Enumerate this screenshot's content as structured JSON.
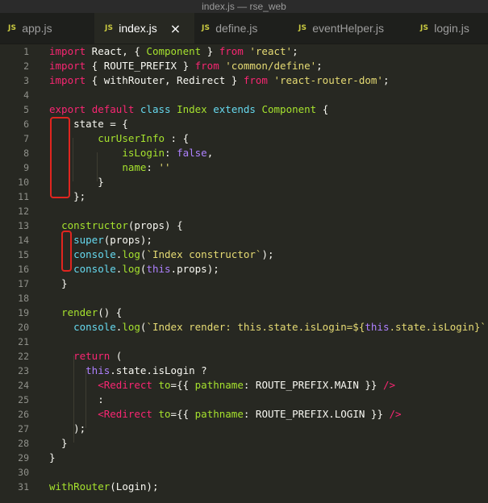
{
  "window": {
    "title": "index.js — rse_web"
  },
  "tabs": [
    {
      "badge": "JS",
      "label": "app.js",
      "active": false
    },
    {
      "badge": "JS",
      "label": "index.js",
      "active": true,
      "close": "×"
    },
    {
      "badge": "JS",
      "label": "define.js",
      "active": false
    },
    {
      "badge": "JS",
      "label": "eventHelper.js",
      "active": false
    },
    {
      "badge": "JS",
      "label": "login.js",
      "active": false
    }
  ],
  "editor": {
    "lines": [
      {
        "n": "1",
        "tokens": [
          [
            "kw",
            "import"
          ],
          [
            "pl",
            " React, { "
          ],
          [
            "fn",
            "Component"
          ],
          [
            "pl",
            " } "
          ],
          [
            "kw",
            "from"
          ],
          [
            "pl",
            " "
          ],
          [
            "st",
            "'react'"
          ],
          [
            "pl",
            ";"
          ]
        ]
      },
      {
        "n": "2",
        "tokens": [
          [
            "kw",
            "import"
          ],
          [
            "pl",
            " { ROUTE_PREFIX } "
          ],
          [
            "kw",
            "from"
          ],
          [
            "pl",
            " "
          ],
          [
            "st",
            "'common/define'"
          ],
          [
            "pl",
            ";"
          ]
        ]
      },
      {
        "n": "3",
        "tokens": [
          [
            "kw",
            "import"
          ],
          [
            "pl",
            " { withRouter, Redirect } "
          ],
          [
            "kw",
            "from"
          ],
          [
            "pl",
            " "
          ],
          [
            "st",
            "'react-router-dom'"
          ],
          [
            "pl",
            ";"
          ]
        ]
      },
      {
        "n": "4",
        "tokens": []
      },
      {
        "n": "5",
        "tokens": [
          [
            "kw",
            "export"
          ],
          [
            "pl",
            " "
          ],
          [
            "kw",
            "default"
          ],
          [
            "pl",
            " "
          ],
          [
            "kb",
            "class"
          ],
          [
            "pl",
            " "
          ],
          [
            "cl",
            "Index"
          ],
          [
            "pl",
            " "
          ],
          [
            "kb",
            "extends"
          ],
          [
            "pl",
            " "
          ],
          [
            "cl",
            "Component"
          ],
          [
            "pl",
            " {"
          ]
        ]
      },
      {
        "n": "6",
        "tokens": [
          [
            "pl",
            "    state = {"
          ]
        ]
      },
      {
        "n": "7",
        "tokens": [
          [
            "pl",
            "        "
          ],
          [
            "fn",
            "curUserInfo"
          ],
          [
            "pl",
            " : {"
          ]
        ]
      },
      {
        "n": "8",
        "tokens": [
          [
            "pl",
            "            "
          ],
          [
            "fn",
            "isLogin"
          ],
          [
            "pl",
            ": "
          ],
          [
            "bo",
            "false"
          ],
          [
            "pl",
            ","
          ]
        ]
      },
      {
        "n": "9",
        "tokens": [
          [
            "pl",
            "            "
          ],
          [
            "fn",
            "name"
          ],
          [
            "pl",
            ": "
          ],
          [
            "st",
            "''"
          ]
        ]
      },
      {
        "n": "10",
        "tokens": [
          [
            "pl",
            "        }"
          ]
        ]
      },
      {
        "n": "11",
        "tokens": [
          [
            "pl",
            "    };"
          ]
        ]
      },
      {
        "n": "12",
        "tokens": []
      },
      {
        "n": "13",
        "tokens": [
          [
            "pl",
            "  "
          ],
          [
            "fn",
            "constructor"
          ],
          [
            "pl",
            "(props) {"
          ]
        ]
      },
      {
        "n": "14",
        "tokens": [
          [
            "pl",
            "    "
          ],
          [
            "kb",
            "super"
          ],
          [
            "pl",
            "(props);"
          ]
        ]
      },
      {
        "n": "15",
        "tokens": [
          [
            "pl",
            "    "
          ],
          [
            "kb",
            "console"
          ],
          [
            "pl",
            "."
          ],
          [
            "fn",
            "log"
          ],
          [
            "pl",
            "("
          ],
          [
            "st",
            "`Index constructor`"
          ],
          [
            "pl",
            ");"
          ]
        ]
      },
      {
        "n": "16",
        "tokens": [
          [
            "pl",
            "    "
          ],
          [
            "kb",
            "console"
          ],
          [
            "pl",
            "."
          ],
          [
            "fn",
            "log"
          ],
          [
            "pl",
            "("
          ],
          [
            "bo",
            "this"
          ],
          [
            "pl",
            "."
          ],
          [
            "pl",
            "props);"
          ]
        ]
      },
      {
        "n": "17",
        "tokens": [
          [
            "pl",
            "  }"
          ]
        ]
      },
      {
        "n": "18",
        "tokens": []
      },
      {
        "n": "19",
        "tokens": [
          [
            "pl",
            "  "
          ],
          [
            "fn",
            "render"
          ],
          [
            "pl",
            "() {"
          ]
        ]
      },
      {
        "n": "20",
        "tokens": [
          [
            "pl",
            "    "
          ],
          [
            "kb",
            "console"
          ],
          [
            "pl",
            "."
          ],
          [
            "fn",
            "log"
          ],
          [
            "pl",
            "("
          ],
          [
            "st",
            "`Index render: this.state.isLogin=${"
          ],
          [
            "bo",
            "this"
          ],
          [
            "st",
            ".state.isLogin}`"
          ],
          [
            "pl",
            ");"
          ]
        ]
      },
      {
        "n": "21",
        "tokens": []
      },
      {
        "n": "22",
        "tokens": [
          [
            "pl",
            "    "
          ],
          [
            "kw",
            "return"
          ],
          [
            "pl",
            " ("
          ]
        ]
      },
      {
        "n": "23",
        "tokens": [
          [
            "pl",
            "      "
          ],
          [
            "bo",
            "this"
          ],
          [
            "pl",
            ".state.isLogin ?"
          ]
        ]
      },
      {
        "n": "24",
        "tokens": [
          [
            "pl",
            "        "
          ],
          [
            "tg",
            "<Redirect"
          ],
          [
            "pl",
            " "
          ],
          [
            "at",
            "to"
          ],
          [
            "pl",
            "={{ "
          ],
          [
            "fn",
            "pathname"
          ],
          [
            "pl",
            ": ROUTE_PREFIX.MAIN }} "
          ],
          [
            "tg",
            "/>"
          ]
        ]
      },
      {
        "n": "25",
        "tokens": [
          [
            "pl",
            "        :"
          ]
        ]
      },
      {
        "n": "26",
        "tokens": [
          [
            "pl",
            "        "
          ],
          [
            "tg",
            "<Redirect"
          ],
          [
            "pl",
            " "
          ],
          [
            "at",
            "to"
          ],
          [
            "pl",
            "={{ "
          ],
          [
            "fn",
            "pathname"
          ],
          [
            "pl",
            ": ROUTE_PREFIX.LOGIN }} "
          ],
          [
            "tg",
            "/>"
          ]
        ]
      },
      {
        "n": "27",
        "tokens": [
          [
            "pl",
            "    );"
          ]
        ]
      },
      {
        "n": "28",
        "tokens": [
          [
            "pl",
            "  }"
          ]
        ]
      },
      {
        "n": "29",
        "tokens": [
          [
            "pl",
            "}"
          ]
        ]
      },
      {
        "n": "30",
        "tokens": []
      },
      {
        "n": "31",
        "tokens": [
          [
            "fn",
            "withRouter"
          ],
          [
            "pl",
            "(Login);"
          ]
        ]
      }
    ]
  },
  "colors": {
    "editor_bg": "#272822",
    "keyword": "#f92672",
    "string": "#e6db74",
    "function": "#a6e22e",
    "builtin": "#66d9ef",
    "constant": "#ae81ff",
    "annotation_box": "#e0251f"
  }
}
